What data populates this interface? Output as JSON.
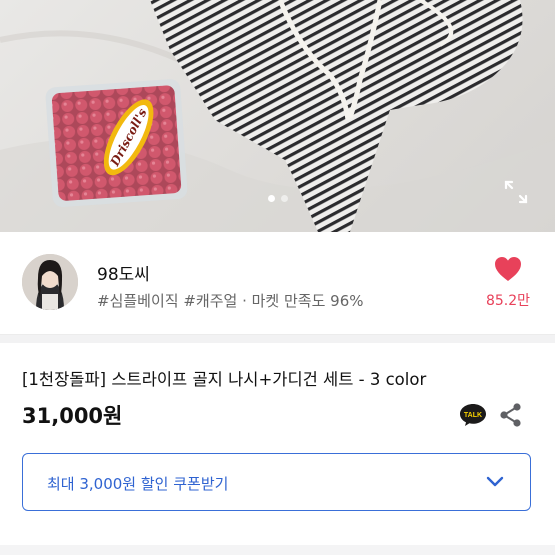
{
  "hero": {
    "image_desc": "product-photo",
    "berry_pack_label": "Driscoll's",
    "carousel": {
      "dot_count": 2,
      "active_index": 0
    },
    "expand_icon": "expand-icon"
  },
  "seller": {
    "name": "98도씨",
    "tags": "#심플베이직 #캐주얼 · 마켓 만족도 96%",
    "like_icon": "heart-icon",
    "like_count": "85.2만",
    "like_color": "#e8415a"
  },
  "product": {
    "title": "[1천장돌파] 스트라이프 골지 나시+가디건 세트 - 3 color",
    "price": "31,000원",
    "kakao_label": "TALK",
    "share_icon": "share-icon"
  },
  "coupon": {
    "label": "최대 3,000원 할인 쿠폰받기",
    "accent": "#2f63d1",
    "chevron_icon": "chevron-down-icon"
  }
}
